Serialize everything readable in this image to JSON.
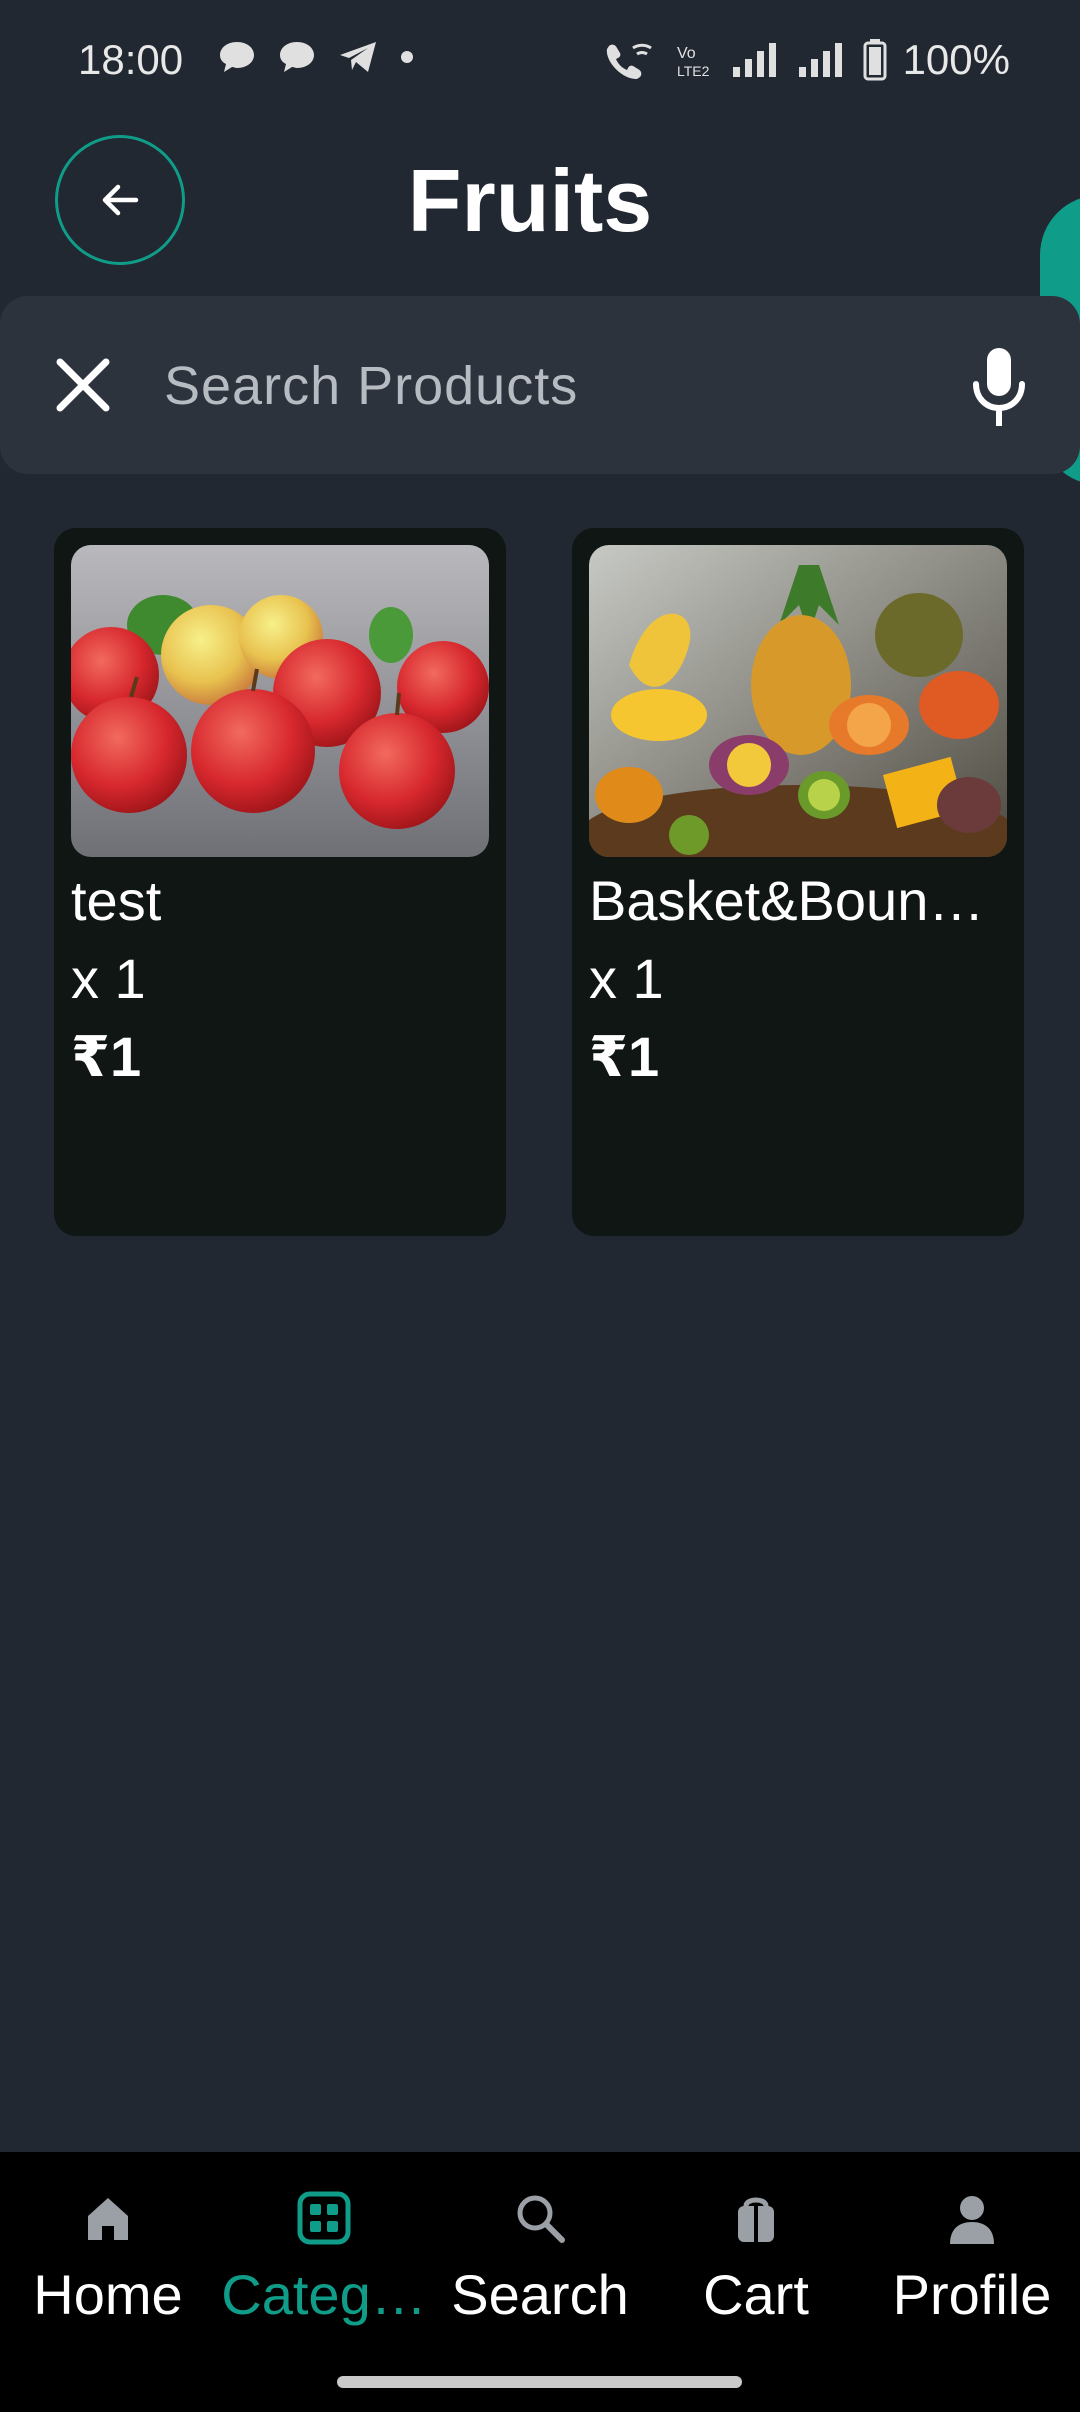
{
  "status_bar": {
    "time": "18:00",
    "battery": "100%"
  },
  "header": {
    "title": "Fruits"
  },
  "search": {
    "placeholder": "Search Products",
    "value": ""
  },
  "products": [
    {
      "name": "test",
      "qty": "x 1",
      "price": "₹1",
      "image": "apples"
    },
    {
      "name": "Basket&Boun…",
      "qty": "x 1",
      "price": "₹1",
      "image": "tropical-fruits"
    }
  ],
  "nav": {
    "items": [
      {
        "label": "Home",
        "icon": "home-icon",
        "active": false
      },
      {
        "label": "Categ…",
        "icon": "categories-icon",
        "active": true
      },
      {
        "label": "Search",
        "icon": "search-icon",
        "active": false
      },
      {
        "label": "Cart",
        "icon": "cart-icon",
        "active": false
      },
      {
        "label": "Profile",
        "icon": "profile-icon",
        "active": false
      }
    ]
  },
  "colors": {
    "accent": "#0f9d8a",
    "background": "#222831",
    "card": "#101614",
    "nav": "#000000"
  }
}
